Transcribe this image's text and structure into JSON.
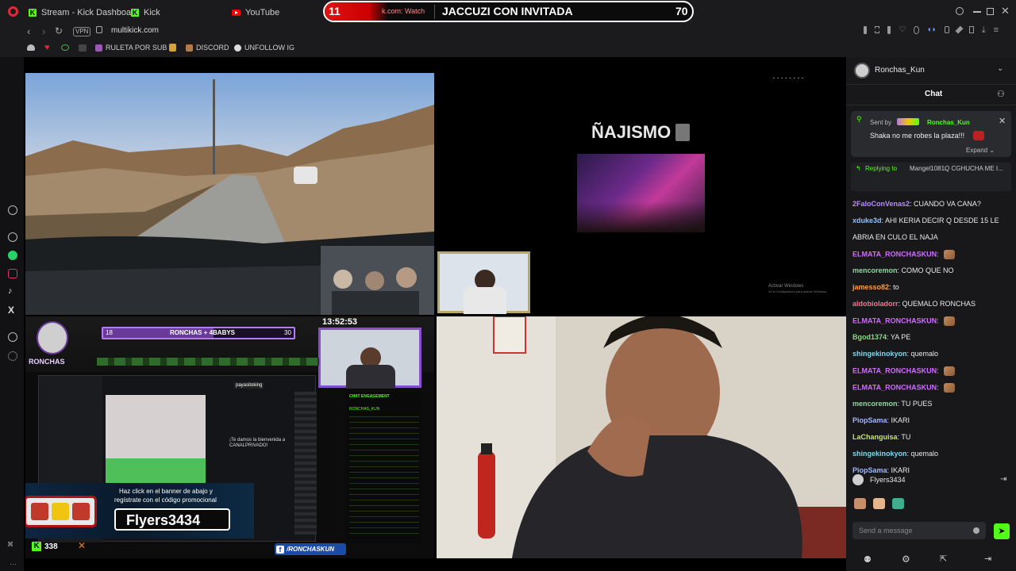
{
  "browser": {
    "tabs": [
      {
        "label": "Stream - Kick Dashboard",
        "icon": "kick-icon"
      },
      {
        "label": "Kick",
        "icon": "kick-icon"
      },
      {
        "label": "YouTube",
        "icon": "youtube-icon"
      }
    ],
    "vpn_label": "VPN",
    "url": "multikick.com",
    "bookmarks": [
      {
        "label": "RULETA POR SUB"
      },
      {
        "label": "DISCORD"
      },
      {
        "label": "UNFOLLOW IG"
      }
    ]
  },
  "overlay_bar": {
    "left_number": "11",
    "ticker_text": "k.com: Watch",
    "title": "JACCUZI CON INVITADA",
    "right_number": "70"
  },
  "stream_top_right": {
    "title": "ÑAJISMO",
    "windows_line1": "Activar Windows",
    "windows_line2": "Ve a Configuración para activar Windows."
  },
  "stream_bottom_left": {
    "goal_left": "18",
    "goal_title": "RONCHAS + 4BABYS",
    "goal_right": "30",
    "clock": "13:52:53",
    "logo_text": "RONCHAS",
    "promo_line1": "Haz click en el banner de abajo  y",
    "promo_line2": "regístrate con el código promocional",
    "promo_code": "Flyers3434",
    "viewer_count": "338",
    "social_handle": "/RONCHASKUN",
    "stats_title": "CHAT  ENGAGEMENT",
    "channel_label": "RONCHAS_KUN",
    "welcome_text": "¡Te damos la bienvenida a CANALPRIVADO!",
    "popup_user": "payasitoking"
  },
  "chat": {
    "channel_name": "Ronchas_Kun",
    "header": "Chat",
    "pinned": {
      "sent_by_label": "Sent by",
      "author": "Ronchas_Kun",
      "message": "Shaka no me robes la plaza!!!",
      "expand_label": "Expand"
    },
    "reply": {
      "label": "Replying to",
      "target": "Mangel1081:",
      "text": "Q CGHUCHA ME I..."
    },
    "messages": [
      {
        "user": "2FaloConVenas2",
        "color": "#b58cff",
        "text": "CUANDO VA CANA?"
      },
      {
        "user": "xduke3d",
        "color": "#8fc1ff",
        "text": "AHI KERIA DECIR Q DESDE 15 LE"
      },
      {
        "user": "",
        "color": "#ffffff",
        "text": "ABRIA EN CULO EL NAJA"
      },
      {
        "user": "ELMATA_RONCHASKUN",
        "color": "#d06cff",
        "text": ""
      },
      {
        "user": "mencoremon",
        "color": "#8fd6a0",
        "text": "COMO QUE NO"
      },
      {
        "user": "jamesso82",
        "color": "#ff9f4a",
        "text": "to"
      },
      {
        "user": "aldobioladorr",
        "color": "#ff6f91",
        "text": "QUEMALO RONCHAS"
      },
      {
        "user": "ELMATA_RONCHASKUN",
        "color": "#d06cff",
        "text": ""
      },
      {
        "user": "Bgod1374",
        "color": "#7ee081",
        "text": "YA PE"
      },
      {
        "user": "shingekinokyon",
        "color": "#7fd7f0",
        "text": "quemalo"
      },
      {
        "user": "ELMATA_RONCHASKUN",
        "color": "#d06cff",
        "text": ""
      },
      {
        "user": "ELMATA_RONCHASKUN",
        "color": "#d06cff",
        "text": ""
      },
      {
        "user": "mencoremon",
        "color": "#8fd6a0",
        "text": "TU PUES"
      },
      {
        "user": "PiopSama",
        "color": "#9fb8ff",
        "text": "IKARI"
      },
      {
        "user": "LaChanguisa",
        "color": "#c6e86a",
        "text": "TU"
      },
      {
        "user": "shingekinokyon",
        "color": "#7fd7f0",
        "text": "quemalo"
      },
      {
        "user": "PiopSama",
        "color": "#9fb8ff",
        "text": "IKARI"
      }
    ],
    "current_user": "Flyers3434",
    "input_placeholder": "Send a message"
  },
  "colors": {
    "kick_green": "#53fc18",
    "accent_red": "#e01212",
    "chrome_bg": "#1b1b1d",
    "chat_bg": "#18181a"
  }
}
